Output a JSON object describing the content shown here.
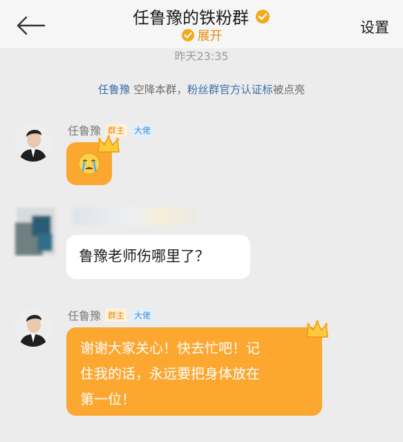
{
  "header": {
    "back_label": "back",
    "title": "任鲁豫的铁粉群",
    "expand_label": "展开",
    "settings_label": "设置"
  },
  "timestamp": "昨天23:35",
  "system_notice": {
    "name": "任鲁豫",
    "middle": " 空降本群，",
    "badge": "粉丝群官方认证标",
    "end": "被点亮"
  },
  "messages": [
    {
      "sender": "任鲁豫",
      "tags": [
        "群主",
        "大佬"
      ],
      "content_type": "emoji",
      "emoji": "crying-face",
      "bubble_color": "#fba730"
    },
    {
      "sender": "",
      "tags": [],
      "content_type": "text",
      "text": "鲁豫老师伤哪里了？",
      "bubble_color": "#ffffff"
    },
    {
      "sender": "任鲁豫",
      "tags": [
        "群主",
        "大佬"
      ],
      "content_type": "text",
      "lines": [
        "谢谢大家关心！快去忙吧！记",
        "住我的话，永远要把身体放在",
        "第一位！"
      ],
      "bubble_color": "#fba730"
    }
  ],
  "colors": {
    "accent": "#e88a10",
    "bubble_orange": "#fba730",
    "link": "#3f6fa8"
  }
}
